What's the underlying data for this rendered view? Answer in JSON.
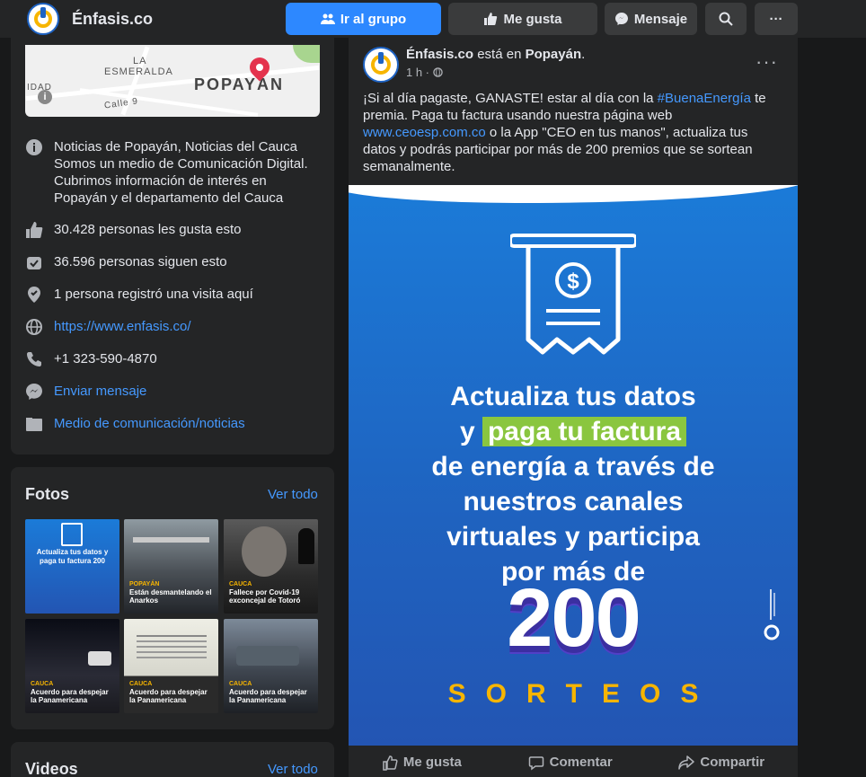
{
  "header": {
    "page_name": "Énfasis.co",
    "buttons": {
      "join": "Ir al grupo",
      "like": "Me gusta",
      "message": "Mensaje",
      "more": "···"
    }
  },
  "map": {
    "labels": [
      "LA",
      "ESMERALDA",
      "POPAYÁN",
      "Calle 9",
      "IDAD"
    ]
  },
  "about": {
    "description": "Noticias de Popayán, Noticias del Cauca Somos un medio de Comunicación Digital. Cubrimos información de interés en Popayán y el departamento del Cauca",
    "likes": "30.428 personas les gusta esto",
    "follows": "36.596 personas siguen esto",
    "checkins": "1 persona registró una visita aquí",
    "website": "https://www.enfasis.co/",
    "phone": "+1 323-590-4870",
    "send_message": "Enviar mensaje",
    "category": "Medio de comunicación/noticias"
  },
  "photos": {
    "title": "Fotos",
    "see_all": "Ver todo",
    "items": [
      {
        "tag": "",
        "caption": "Actualiza tus datos y paga tu factura 200"
      },
      {
        "tag": "POPAYÁN",
        "caption": "Están desmantelando el Anarkos"
      },
      {
        "tag": "CAUCA",
        "caption": "Fallece por Covid-19 exconcejal de Totoró"
      },
      {
        "tag": "CAUCA",
        "caption": "Acuerdo para despejar la Panamericana"
      },
      {
        "tag": "CAUCA",
        "caption": "Acuerdo para despejar la Panamericana"
      },
      {
        "tag": "CAUCA",
        "caption": "Acuerdo para despejar la Panamericana"
      }
    ]
  },
  "videos": {
    "title": "Videos",
    "see_all": "Ver todo"
  },
  "post": {
    "author": "Énfasis.co",
    "location_prefix": "está en",
    "location": "Popayán",
    "time": "1 h ·",
    "text_1": "¡Si al día pagaste, GANASTE! estar al día con la",
    "hashtag": "#BuenaEnergía",
    "text_2": "te premia. Paga tu factura usando nuestra página web",
    "link": "www.ceoesp.com.co",
    "text_3": "o la App \"CEO en tus manos\", actualiza tus datos y podrás participar por más de 200 premios que se sortean semanalmente.",
    "creative": {
      "line1": "Actualiza tus datos",
      "line2_pre": "y",
      "line2_hl": "paga tu factura",
      "line3": "de energía a través de",
      "line4": "nuestros canales",
      "line5": "virtuales y participa",
      "line6": "por más de",
      "number": "200",
      "sorteos": "SORTEOS"
    },
    "actions": {
      "like": "Me gusta",
      "comment": "Comentar",
      "share": "Compartir"
    }
  },
  "colors": {
    "accent": "#2d88ff",
    "link": "#4599ff",
    "brand_yellow": "#f7b500",
    "highlight_green": "#8ac63f"
  }
}
